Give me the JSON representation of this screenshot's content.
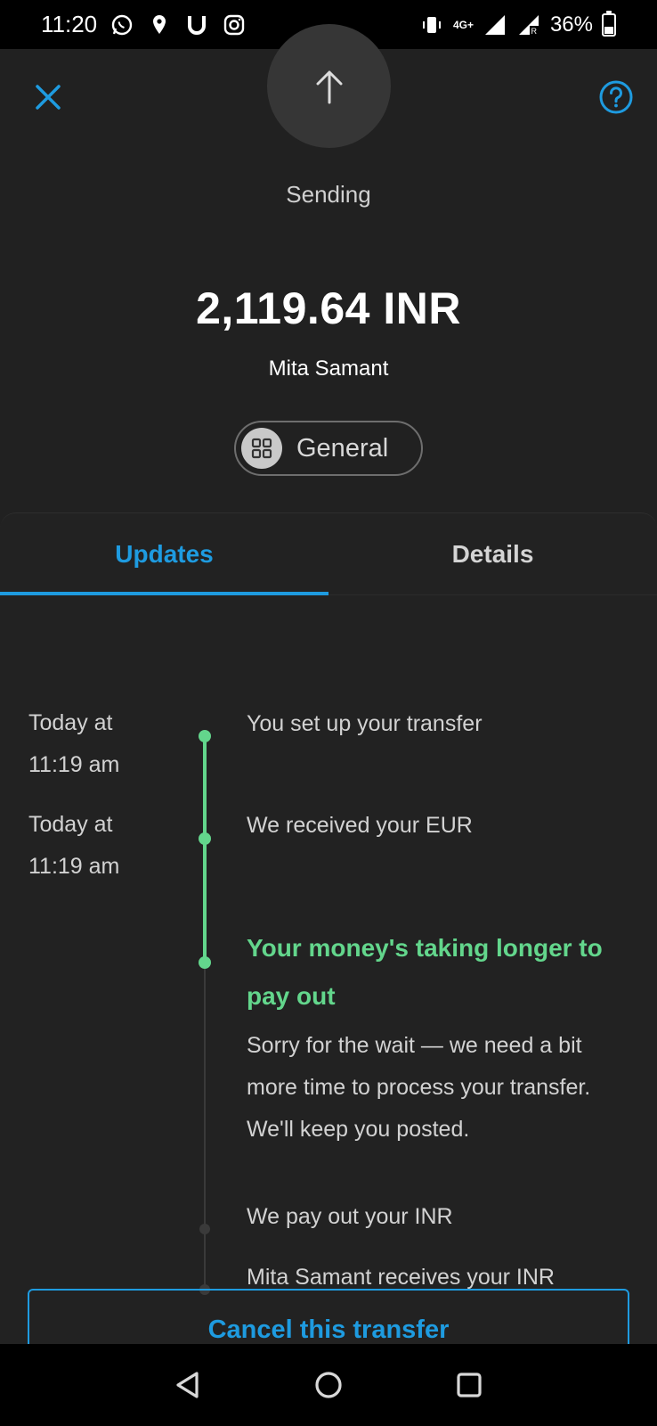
{
  "status_bar": {
    "time": "11:20",
    "network": "4G+",
    "battery": "36%"
  },
  "header": {
    "status_label": "Sending",
    "amount": "2,119.64 INR",
    "recipient": "Mita Samant",
    "category": "General"
  },
  "tabs": [
    {
      "label": "Updates",
      "active": true
    },
    {
      "label": "Details",
      "active": false
    }
  ],
  "timeline": {
    "events": [
      {
        "time_line1": "Today at",
        "time_line2": "11:19 am",
        "text": "You set up your transfer",
        "state": "done"
      },
      {
        "time_line1": "Today at",
        "time_line2": "11:19 am",
        "text": "We received your EUR",
        "state": "done"
      },
      {
        "title": "Your money's taking longer to pay out",
        "body": "Sorry for the wait — we need a bit more time to process your transfer. We'll keep you posted.",
        "state": "current"
      },
      {
        "text": "We pay out your INR",
        "state": "pending"
      },
      {
        "text": "Mita Samant receives your INR",
        "state": "pending"
      }
    ]
  },
  "actions": {
    "cancel_label": "Cancel this transfer"
  },
  "colors": {
    "accent": "#1e9be0",
    "success": "#63d68c",
    "background": "#212121"
  }
}
